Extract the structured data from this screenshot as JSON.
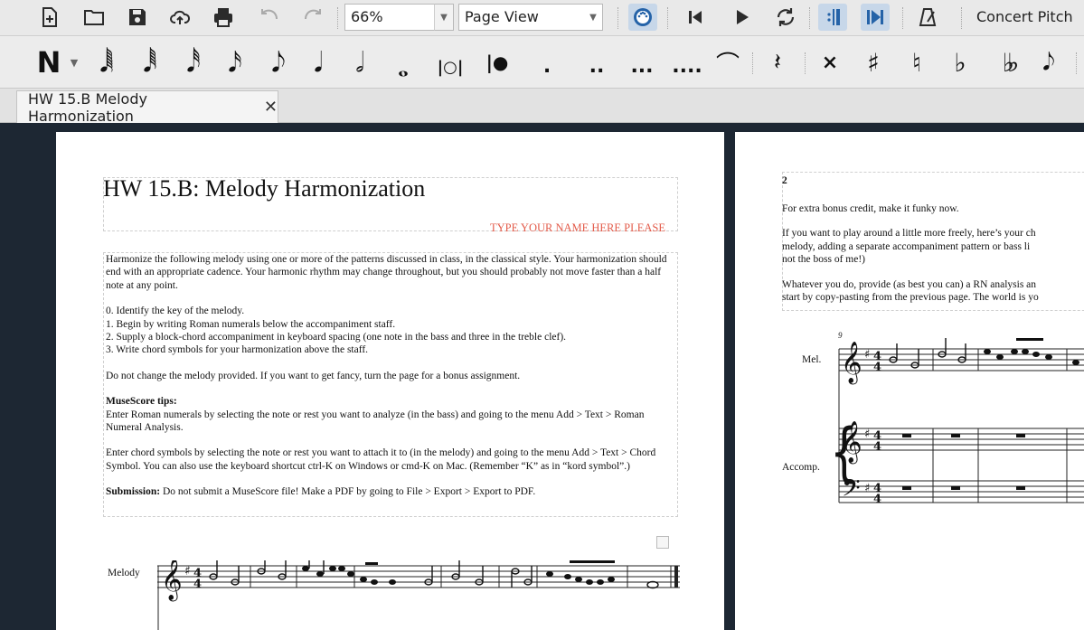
{
  "toolbar": {
    "zoom_value": "66%",
    "view_mode": "Page View",
    "concert_pitch_label": "Concert Pitch"
  },
  "note_input": {
    "mode_glyph": "𝅘𝅥𝅮",
    "dots": [
      ".",
      "..",
      "...",
      "...."
    ]
  },
  "tab": {
    "title": "HW 15.B Melody Harmonization",
    "close": "✕"
  },
  "page1": {
    "title": "HW 15.B: Melody Harmonization",
    "name_hint": "TYPE YOUR NAME HERE PLEASE",
    "intro": "Harmonize the following melody using one or more of the patterns discussed in class, in the classical style. Your harmonization should end with an appropriate cadence. Your harmonic rhythm may change throughout, but you should probably not move faster than a half note at any point.",
    "steps": [
      "0. Identify the key of the melody.",
      "1. Begin by writing Roman numerals below the accompaniment staff.",
      "2. Supply a block-chord accompaniment in keyboard spacing (one note in the bass and three in the treble clef).",
      "3. Write chord symbols for your harmonization above the staff."
    ],
    "dont_change": "Do not change the melody provided. If you want to get fancy, turn the page for a bonus assignment.",
    "tips_heading": "MuseScore tips:",
    "tip1": "Enter Roman numerals by selecting the note or rest you want to analyze (in the bass) and going to the menu Add > Text > Roman Numeral Analysis.",
    "tip2": "Enter chord symbols by selecting the note or rest you want to attach it to (in the melody) and going to the menu Add > Text > Chord Symbol. You can also use the keyboard shortcut ctrl-K on Windows or cmd-K on Mac. (Remember “K” as in “kord symbol”.)",
    "submission_label": "Submission:",
    "submission_text": " Do not submit a MuseScore file! Make a PDF by going to File > Export > Export to PDF.",
    "staff_label": "Melody"
  },
  "page2": {
    "page_number": "2",
    "line1": "For extra bonus credit, make it funky now.",
    "para2a": "If you want to play around a little more freely, here’s your ch",
    "para2b": "melody, adding a separate accompaniment pattern or bass li",
    "para2c": "not the boss of me!)",
    "para3a": "Whatever you do, provide (as best you can) a RN analysis an",
    "para3b": "start by copy-pasting from the previous page. The world is yo",
    "measure_number": "9",
    "mel_label": "Mel.",
    "accomp_label": "Accomp."
  }
}
